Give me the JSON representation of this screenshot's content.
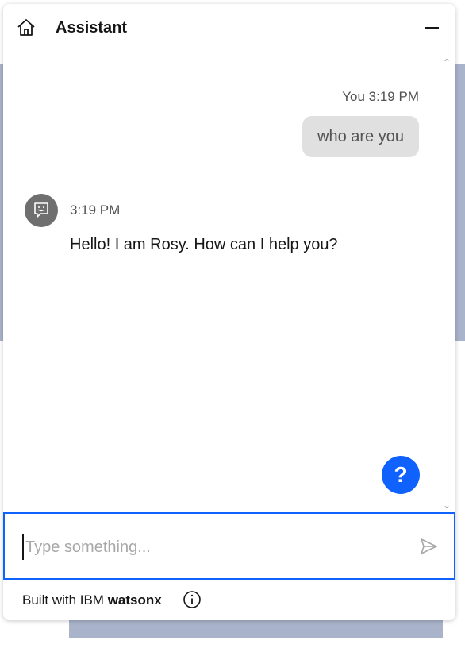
{
  "header": {
    "title": "Assistant",
    "home_icon": "home-icon",
    "minimize_icon": "minimize-icon"
  },
  "messages": [
    {
      "sender": "user",
      "meta": "You 3:19 PM",
      "text": "who are you"
    },
    {
      "sender": "bot",
      "time": "3:19 PM",
      "text": "Hello! I am Rosy. How can I help you?",
      "avatar_icon": "bot-avatar-icon"
    }
  ],
  "help_button": {
    "label": "?"
  },
  "input": {
    "placeholder": "Type something...",
    "value": "",
    "send_icon": "send-icon"
  },
  "footer": {
    "prefix": "Built with IBM ",
    "brand": "watsonx",
    "info_icon": "info-icon"
  },
  "colors": {
    "accent": "#0f62fe",
    "user_bubble": "#e0e0e0",
    "avatar": "#6f6f6f",
    "background_page": "#a9b3ca"
  }
}
